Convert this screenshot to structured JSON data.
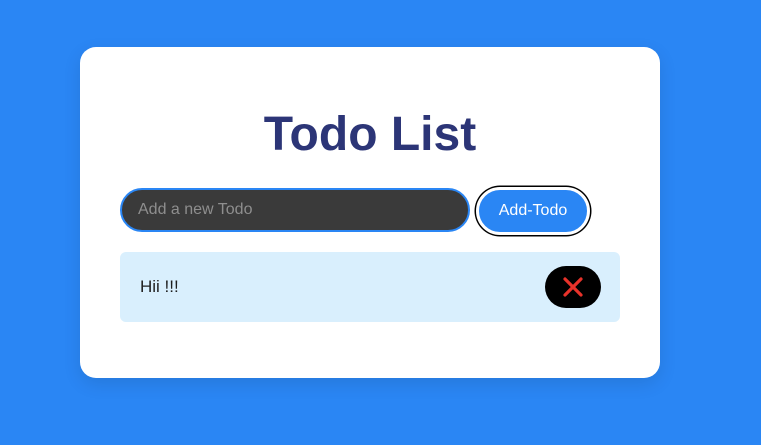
{
  "app": {
    "title": "Todo List"
  },
  "form": {
    "input_value": "",
    "input_placeholder": "Add a new Todo",
    "add_button_label": "Add-Todo"
  },
  "todos": [
    {
      "text": "Hii !!!",
      "delete_icon": "close-icon"
    }
  ],
  "colors": {
    "background": "#2a86f4",
    "title": "#2c3577",
    "input_background": "#3a3a3a",
    "accent": "#2a86f4",
    "todo_item_background": "#d9effd",
    "delete_button_background": "#000000",
    "delete_icon": "#e8322a"
  }
}
